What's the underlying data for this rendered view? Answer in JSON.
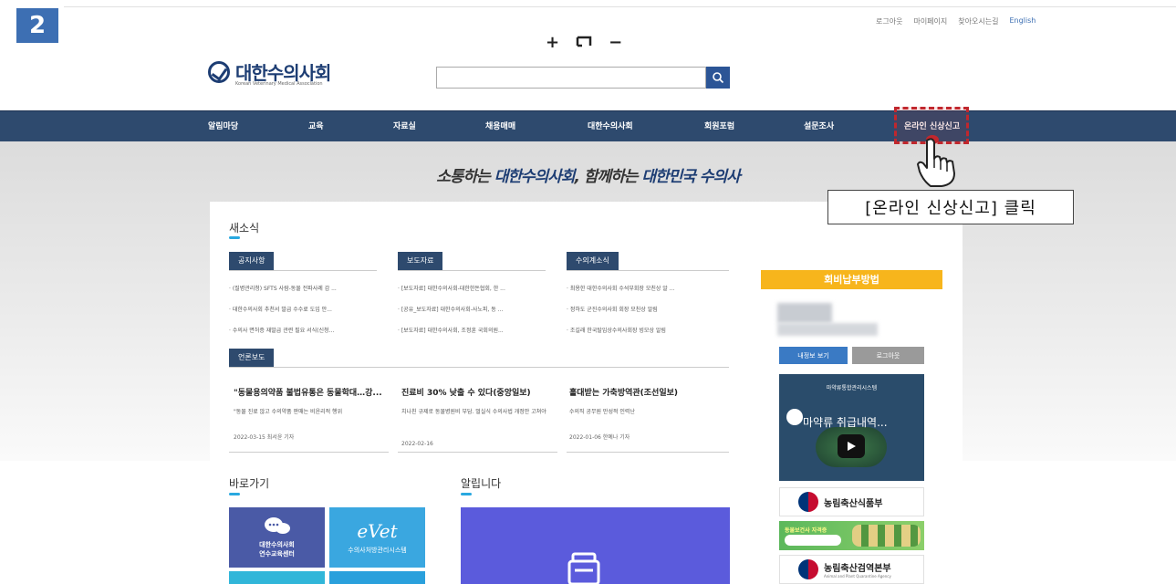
{
  "step_badge": "2",
  "util_links": [
    "로그아웃",
    "마이페이지",
    "찾아오시는길",
    "English"
  ],
  "zoom": {
    "plus": "+",
    "reset": "ㄷ",
    "minus": "−"
  },
  "logo": {
    "name": "대한수의사회",
    "sub": "Korean Veterinary Medical Association"
  },
  "search": {
    "placeholder": ""
  },
  "gnb": [
    "알림마당",
    "교육",
    "자료실",
    "채용매매",
    "대한수의사회",
    "회원포럼",
    "설문조사",
    "온라인 신상신고"
  ],
  "callout": "[온라인 신상신고] 클릭",
  "slogan": {
    "p1": "소통하는 ",
    "p2": "대한수의사회",
    "p3": ", 함께하는 ",
    "p4": "대한민국 수의사"
  },
  "news": {
    "title": "새소식",
    "tabs": [
      {
        "label": "공지사항",
        "items": [
          "(질병관리청) SFTS 사람-동물 전파사례 감 ...",
          "대한수의사회 추천서 발급 수수료 도입 안...",
          "수의사 면허증 재발급 관련 필요 서식(신청..."
        ]
      },
      {
        "label": "보도자료",
        "items": [
          "[보도자료] 대한수의사회-대한한돈협회, 한 ...",
          "[공유_보도자료] 대한수의사회-사노피, 동 ...",
          "[보도자료] 대한수의사회, 조정훈 국회의원..."
        ]
      },
      {
        "label": "수의계소식",
        "items": [
          "최용한 대한수의사회 수석부회장 모친상 알 ...",
          "정하도 군진수의사회 회장 모친상 알림",
          "조길래 한국탈임상수의사회장 빙모상 알림"
        ]
      }
    ]
  },
  "press": {
    "label": "언론보도",
    "items": [
      {
        "head": "\"동물용의약품 불법유통은 동물학대…강...",
        "body": "\"동물 진료 않고 수의약품 판매는 비윤리적 행위",
        "date": "2022-03-15 최서윤 기자"
      },
      {
        "head": "진료비 30% 낮출 수 있다(중앙일보)",
        "body": "치나친 규제로 동물병원비 부담. 멀실식 수의사법 개정안 고쳐야",
        "date": "2022-02-16"
      },
      {
        "head": "홀대받는 가축방역관(조선일보)",
        "body": "수의직 공무원 만성적 인력난",
        "date": "2022-01-06 한예나 기자"
      }
    ]
  },
  "quick": {
    "title": "바로가기",
    "tile1": "대한수의사회\n연수교육센터",
    "tile2_logo": "eVet",
    "tile2": "수의사처방관리시스템"
  },
  "notice": {
    "title": "알립니다"
  },
  "side": {
    "head": "회비납부방법",
    "btn_myinfo": "내정보 보기",
    "btn_logout": "로그아웃",
    "video_title": "마약류통합관리시스템",
    "video_caption": "마약류 취급내역...",
    "banner1": "농림축산식품부",
    "banner_green": "동물보건사 자격증",
    "banner2": "농림축산검역본부",
    "banner2_sub": "Animal and Plant Quarantine Agency"
  }
}
